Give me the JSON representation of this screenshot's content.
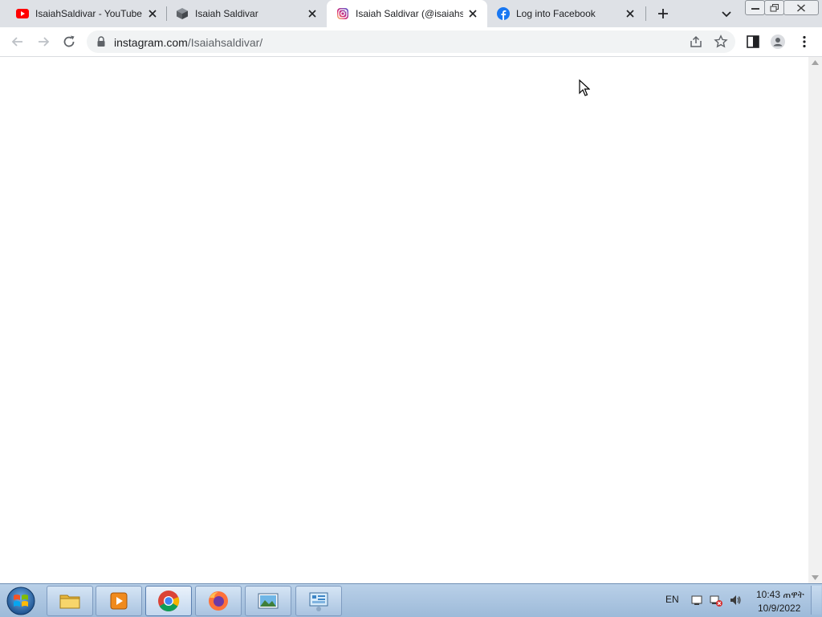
{
  "browser": {
    "tabs": [
      {
        "title": "IsaiahSaldivar - YouTube",
        "favicon": "youtube-icon",
        "active": false
      },
      {
        "title": "Isaiah Saldivar",
        "favicon": "cube-icon",
        "active": false
      },
      {
        "title": "Isaiah Saldivar (@isaiahsa",
        "favicon": "instagram-icon",
        "active": true
      },
      {
        "title": "Log into Facebook",
        "favicon": "facebook-icon",
        "active": false
      }
    ],
    "url": {
      "domain": "instagram.com",
      "path": "/Isaiahsaldivar/"
    }
  },
  "taskbar": {
    "apps": [
      {
        "name": "windows-explorer",
        "icon": "folder-icon"
      },
      {
        "name": "media-player",
        "icon": "media-player-icon"
      },
      {
        "name": "chrome",
        "icon": "chrome-icon",
        "active": true
      },
      {
        "name": "firefox",
        "icon": "firefox-icon"
      },
      {
        "name": "photo-viewer",
        "icon": "photo-icon"
      },
      {
        "name": "control-panel",
        "icon": "control-panel-icon"
      }
    ],
    "language": "EN",
    "clock": {
      "time": "10:43 ጠዋት",
      "date": "10/9/2022"
    }
  },
  "colors": {
    "tabstrip": "#dee1e6",
    "omnibox": "#f1f3f4",
    "taskbar": "#a9c3e0"
  }
}
